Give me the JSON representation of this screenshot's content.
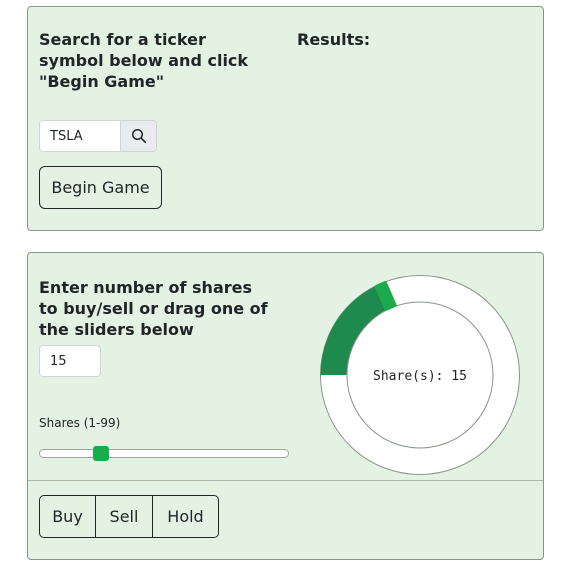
{
  "search_card": {
    "heading": "Search for a ticker symbol below and click \"Begin Game\"",
    "results_heading": "Results:",
    "ticker_value": "TSLA",
    "search_icon": "search-icon",
    "begin_label": "Begin Game"
  },
  "shares_card": {
    "heading": "Enter number of shares to buy/sell or drag one of the sliders below",
    "shares_value": "15",
    "slider_label": "Shares (1-99)",
    "slider": {
      "min": 1,
      "max": 99,
      "value": 15
    },
    "dial_text": "Share(s): 15",
    "dial_value": 15,
    "dial_max": 99,
    "buttons": {
      "buy": "Buy",
      "sell": "Sell",
      "hold": "Hold"
    }
  },
  "colors": {
    "card_bg": "#e4f2e3",
    "accent": "#1bab4c",
    "dial_fill": "#1e8a4d"
  }
}
